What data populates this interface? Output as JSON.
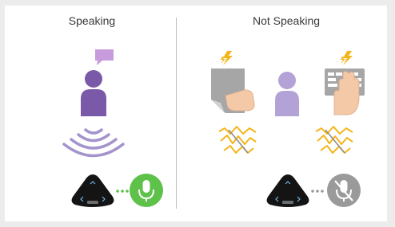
{
  "headings": {
    "left": "Speaking",
    "right": "Not Speaking"
  },
  "colors": {
    "person_speaking": "#7a5aa8",
    "person_idle": "#b2a2d6",
    "speech_bubble": "#c79bdc",
    "waves": "#a493cc",
    "noise_yellow": "#f4b51b",
    "mic_active": "#5dc14a",
    "mic_muted": "#9a9a9a",
    "device": "#141414"
  },
  "icons": {
    "left": [
      "speech-bubble-icon",
      "person-speaking-icon",
      "sound-waves-icon",
      "speakerphone-device-icon",
      "microphone-active-icon"
    ],
    "right": [
      "lightning-icon",
      "paper-rustle-icon",
      "person-idle-icon",
      "lightning-icon",
      "keyboard-typing-icon",
      "noise-muted-icon",
      "speakerphone-device-icon",
      "microphone-muted-icon"
    ]
  }
}
